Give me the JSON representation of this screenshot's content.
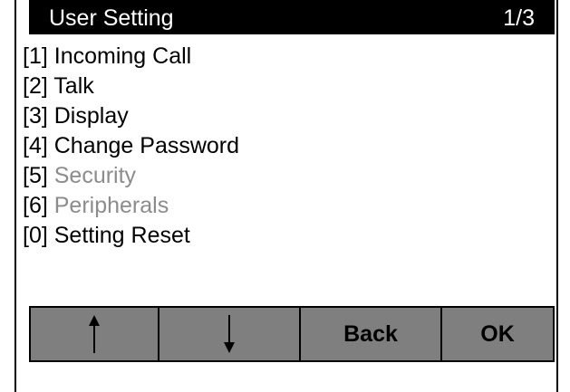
{
  "header": {
    "title": "User Setting",
    "page": "1/3"
  },
  "menu": {
    "items": [
      {
        "key": "[1]",
        "label": "Incoming Call",
        "enabled": true
      },
      {
        "key": "[2]",
        "label": "Talk",
        "enabled": true
      },
      {
        "key": "[3]",
        "label": "Display",
        "enabled": true
      },
      {
        "key": "[4]",
        "label": "Change Password",
        "enabled": true
      },
      {
        "key": "[5]",
        "label": "Security",
        "enabled": false
      },
      {
        "key": "[6]",
        "label": "Peripherals",
        "enabled": false
      },
      {
        "key": "[0]",
        "label": "Setting Reset",
        "enabled": true
      }
    ]
  },
  "softkeys": {
    "up_icon": "arrow-up-icon",
    "down_icon": "arrow-down-icon",
    "back_label": "Back",
    "ok_label": "OK"
  },
  "colors": {
    "title_bg": "#000000",
    "title_fg": "#ffffff",
    "disabled_text": "#8c8c8c",
    "softkey_bg": "#7f7f7f"
  }
}
